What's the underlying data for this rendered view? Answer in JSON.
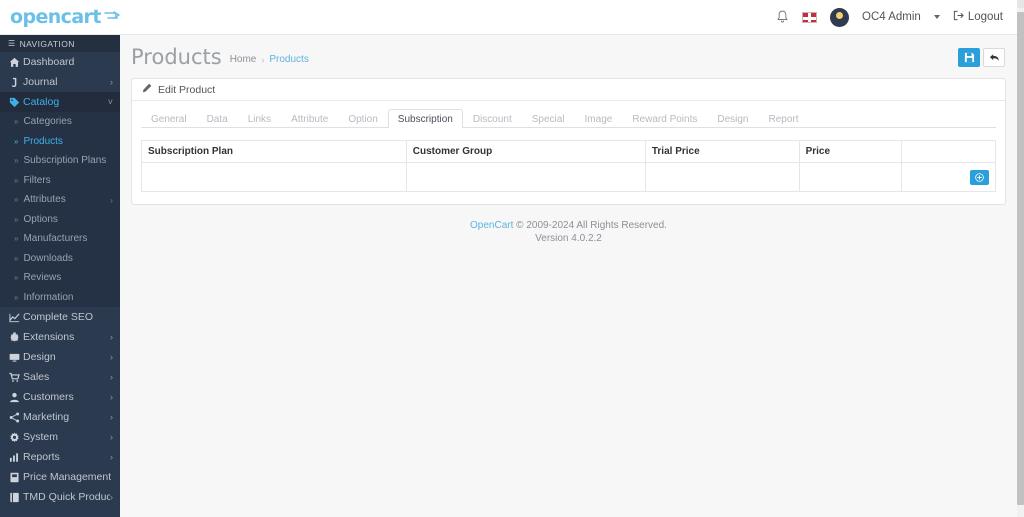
{
  "header": {
    "logo_text": "opencart",
    "logo_icon": "shopping-cart-icon",
    "bell_icon": "notification-bell-icon",
    "flag_icon": "english-flag-icon",
    "user_name": "OC4 Admin",
    "logout_label": "Logout"
  },
  "sidebar": {
    "nav_header": "NAVIGATION",
    "items": [
      {
        "label": "Dashboard",
        "icon": "home-icon",
        "has_children": false
      },
      {
        "label": "Journal",
        "icon": "journal-icon",
        "has_children": true
      },
      {
        "label": "Catalog",
        "icon": "tag-icon",
        "has_children": true,
        "expanded": true,
        "children": [
          {
            "label": "Categories",
            "has_children": false
          },
          {
            "label": "Products",
            "has_children": false,
            "active": true
          },
          {
            "label": "Subscription Plans",
            "has_children": false
          },
          {
            "label": "Filters",
            "has_children": false
          },
          {
            "label": "Attributes",
            "has_children": true
          },
          {
            "label": "Options",
            "has_children": false
          },
          {
            "label": "Manufacturers",
            "has_children": false
          },
          {
            "label": "Downloads",
            "has_children": false
          },
          {
            "label": "Reviews",
            "has_children": false
          },
          {
            "label": "Information",
            "has_children": false
          }
        ]
      },
      {
        "label": "Complete SEO",
        "icon": "chart-line-icon",
        "has_children": false
      },
      {
        "label": "Extensions",
        "icon": "puzzle-icon",
        "has_children": true
      },
      {
        "label": "Design",
        "icon": "desktop-icon",
        "has_children": true
      },
      {
        "label": "Sales",
        "icon": "cart-icon",
        "has_children": true
      },
      {
        "label": "Customers",
        "icon": "user-icon",
        "has_children": true
      },
      {
        "label": "Marketing",
        "icon": "share-icon",
        "has_children": true
      },
      {
        "label": "System",
        "icon": "gear-icon",
        "has_children": true
      },
      {
        "label": "Reports",
        "icon": "bar-chart-icon",
        "has_children": true
      },
      {
        "label": "Price Management",
        "icon": "price-tag-icon",
        "has_children": false
      },
      {
        "label": "TMD Quick Product",
        "icon": "book-icon",
        "has_children": true
      }
    ]
  },
  "page": {
    "title": "Products",
    "breadcrumb": [
      {
        "label": "Home",
        "link": false
      },
      {
        "label": "Products",
        "link": true
      }
    ],
    "actions": {
      "save_icon": "save-floppy-icon",
      "back_icon": "reply-arrow-icon"
    }
  },
  "card": {
    "header_icon": "pencil-icon",
    "header_title": "Edit Product",
    "tabs": [
      {
        "label": "General",
        "active": false
      },
      {
        "label": "Data",
        "active": false
      },
      {
        "label": "Links",
        "active": false
      },
      {
        "label": "Attribute",
        "active": false
      },
      {
        "label": "Option",
        "active": false
      },
      {
        "label": "Subscription",
        "active": true
      },
      {
        "label": "Discount",
        "active": false
      },
      {
        "label": "Special",
        "active": false
      },
      {
        "label": "Image",
        "active": false
      },
      {
        "label": "Reward Points",
        "active": false
      },
      {
        "label": "Design",
        "active": false
      },
      {
        "label": "Report",
        "active": false
      }
    ],
    "table": {
      "columns": [
        "Subscription Plan",
        "Customer Group",
        "Trial Price",
        "Price",
        ""
      ],
      "rows": [
        [
          "",
          "",
          "",
          "",
          ""
        ]
      ],
      "add_button_icon": "plus-icon"
    }
  },
  "footer": {
    "brand": "OpenCart",
    "copyright": " © 2009-2024 All Rights Reserved.",
    "version": "Version 4.0.2.2"
  },
  "colors": {
    "accent": "#2b9fda",
    "sidebar_bg": "#2b3a4f",
    "sidebar_active": "#3eb0e8",
    "logo": "#6bc0e8"
  }
}
